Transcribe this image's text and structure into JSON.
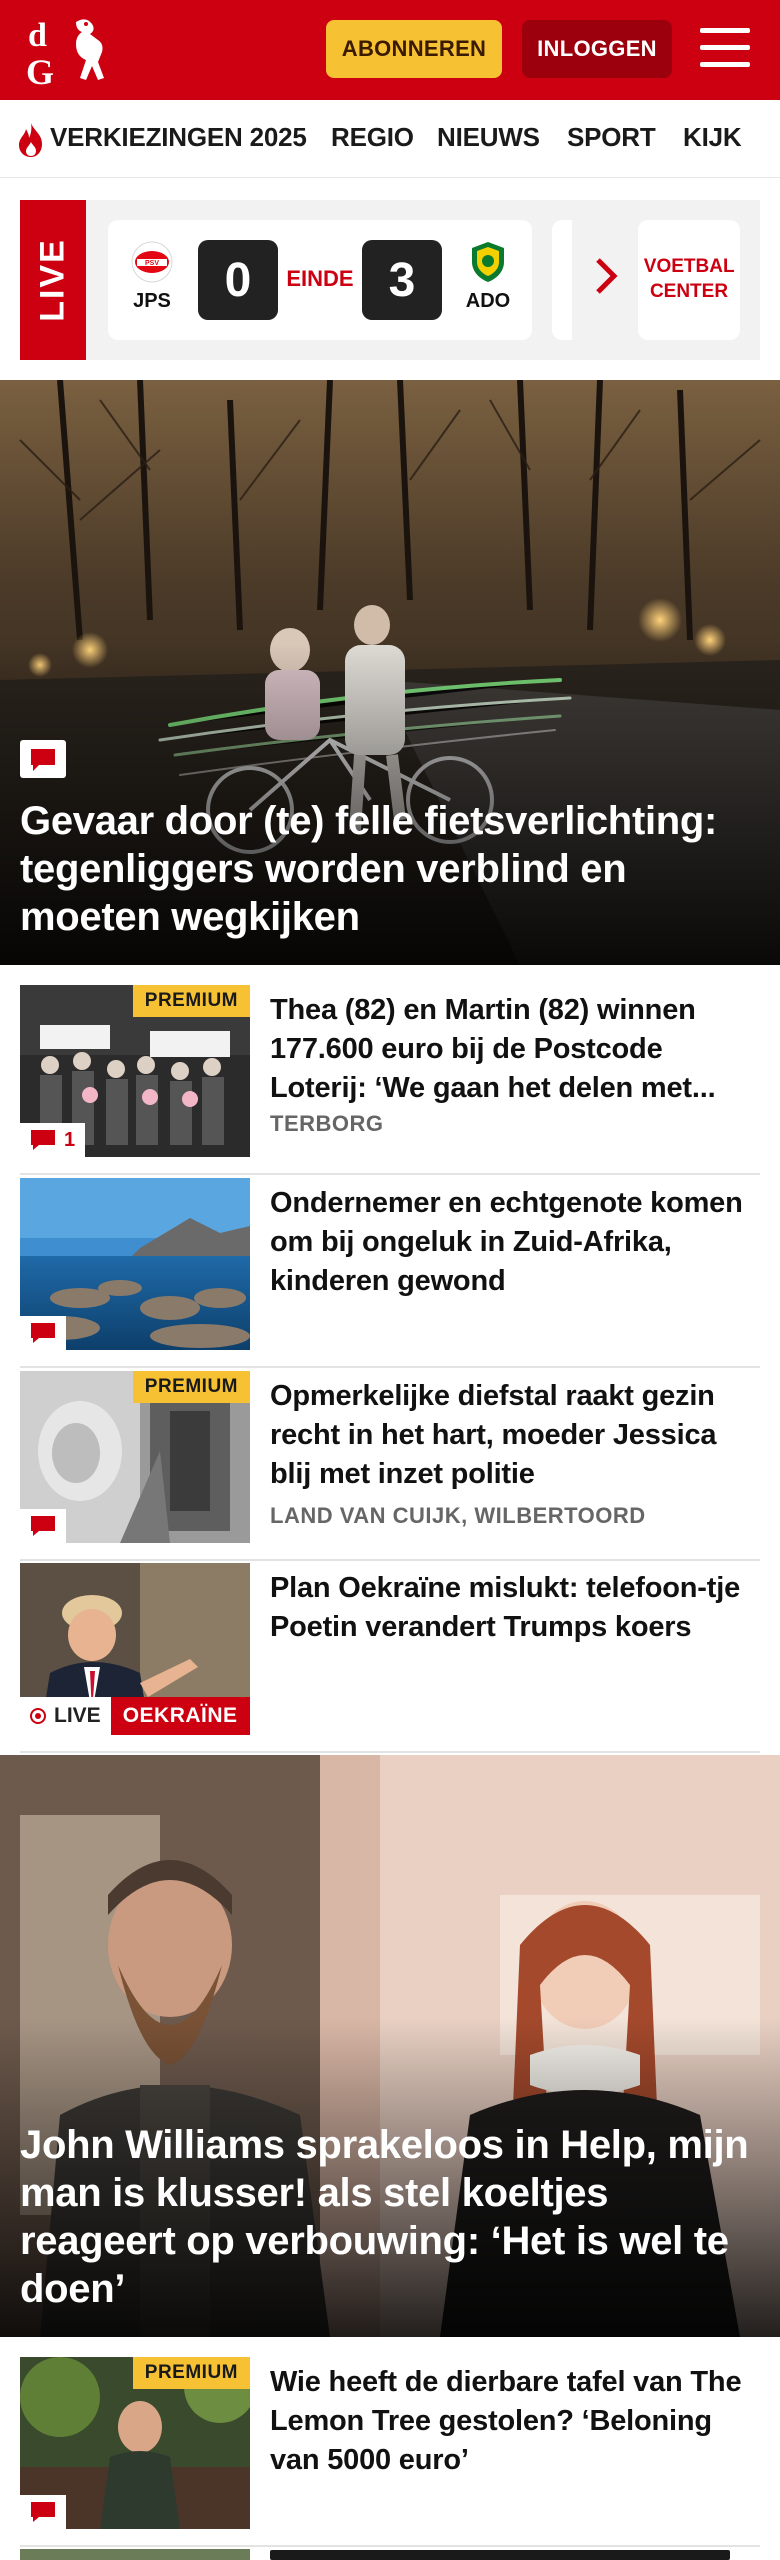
{
  "header": {
    "subscribe_label": "ABONNEREN",
    "login_label": "INLOGGEN",
    "brand_color": "#cc0010",
    "accent_color": "#f6c133"
  },
  "nav": {
    "items": [
      {
        "label": "VERKIEZINGEN 2025",
        "icon": "flame-icon"
      },
      {
        "label": "REGIO"
      },
      {
        "label": "NIEUWS"
      },
      {
        "label": "SPORT"
      },
      {
        "label": "KIJK"
      }
    ]
  },
  "live": {
    "tab_label": "LIVE",
    "match": {
      "home_team": "JPS",
      "home_score": "0",
      "status": "EINDE",
      "away_score": "3",
      "away_team": "ADO"
    },
    "voetbal_center_label": "VOETBAL CENTER"
  },
  "hero": {
    "title": "Gevaar door (te) felle fietsverlichting: tegenliggers worden verblind en moeten wegkijken",
    "icon": "comment-icon"
  },
  "articles": [
    {
      "title": "Thea (82) en Martin (82) winnen 177.600 euro bij de Postcode Loterij: ‘We gaan het delen met...",
      "location": "TERBORG",
      "premium": "PREMIUM",
      "comments": "1"
    },
    {
      "title": "Ondernemer en echtgenote komen om bij ongeluk in Zuid-Afrika, kinderen gewond"
    },
    {
      "title": "Opmerkelijke diefstal raakt gezin recht in het hart, moeder Jessica blij met inzet politie",
      "location": "LAND VAN CUIJK, WILBERTOORD",
      "premium": "PREMIUM"
    },
    {
      "title": "Plan Oekraïne mislukt: telefoon-tje Poetin verandert Trumps koers",
      "live_label": "LIVE",
      "topic": "OEKRAÏNE"
    }
  ],
  "hero2": {
    "title": "John Williams sprakeloos in Help, mijn man is klusser! als stel koeltjes reageert op verbouwing: ‘Het is wel te doen’"
  },
  "articles2": [
    {
      "title": "Wie heeft de dierbare tafel van The Lemon Tree gestolen? ‘Beloning van 5000 euro’",
      "premium": "PREMIUM"
    }
  ]
}
